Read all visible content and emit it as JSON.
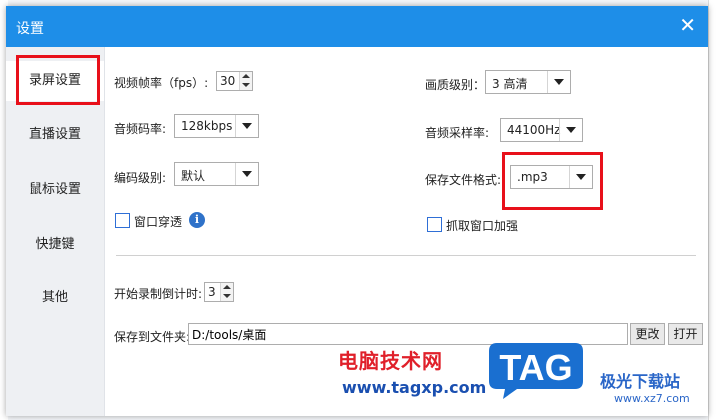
{
  "window": {
    "title": "设置"
  },
  "sidebar": {
    "items": [
      {
        "label": "录屏设置"
      },
      {
        "label": "直播设置"
      },
      {
        "label": "鼠标设置"
      },
      {
        "label": "快捷键"
      },
      {
        "label": "其他"
      }
    ]
  },
  "form": {
    "fps_label": "视频帧率（fps）:",
    "fps_value": "30",
    "quality_label": "画质级别：",
    "quality_value": "3 高清",
    "audio_bitrate_label": "音频码率:",
    "audio_bitrate_value": "128kbps",
    "sample_rate_label": "音频采样率:",
    "sample_rate_value": "44100Hz",
    "encoding_label": "编码级别:",
    "encoding_value": "默认",
    "format_label": "保存文件格式:",
    "format_value": ".mp3",
    "window_passthrough_label": "窗口穿透",
    "enhance_capture_label": "抓取窗口加强",
    "countdown_label": "开始录制倒计时:",
    "countdown_value": "3",
    "save_folder_label": "保存到文件夹:",
    "save_folder_value": "D:/tools/桌面",
    "change_button": "更改",
    "open_button": "打开"
  },
  "watermark": {
    "site_name": "电脑技术网",
    "site_url": "www.tagxp.com",
    "tag_logo": "TAG",
    "brand2": "极光下载站",
    "brand2_url": "www.xz7.com"
  },
  "colors": {
    "titlebar": "#1e8ee8",
    "highlight": "#e8101a",
    "tag_logo_bg": "#1a6fd0"
  }
}
